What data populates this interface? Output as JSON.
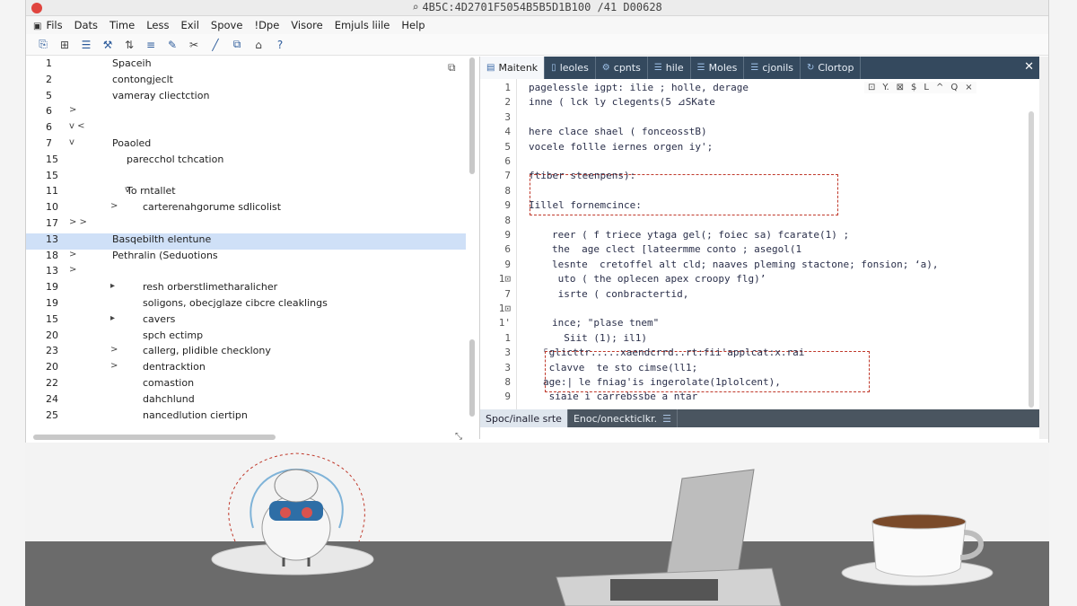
{
  "window": {
    "title": "4B5C:4D2701F5054B5B5D1B100 /41 D00628"
  },
  "menu": [
    "Fils",
    "Dats",
    "Time",
    "Less",
    "Exil",
    "Spove",
    "!Dpe",
    "Visore",
    "Emjuls liile",
    "Help"
  ],
  "toolbar_icons": [
    "file-icon",
    "save-icon",
    "list-icon",
    "tools-icon",
    "sort-icon",
    "format-icon",
    "edit-icon",
    "cut-icon",
    "pen-icon",
    "copy-icon",
    "bookmark-icon",
    "help-icon"
  ],
  "tree": {
    "rows": [
      {
        "ln": "1",
        "label": "Spaceih",
        "arrow": "",
        "indent": 0
      },
      {
        "ln": "2",
        "label": "contongjeclt",
        "arrow": "",
        "indent": 0
      },
      {
        "ln": "5",
        "label": "vameray cliectction",
        "arrow": "",
        "indent": 0
      },
      {
        "ln": "6",
        "label": "",
        "arrow": ">",
        "indent": 0
      },
      {
        "ln": "6",
        "label": "",
        "arrow": "v <",
        "indent": 0
      },
      {
        "ln": "7",
        "label": "Poaoled",
        "arrow": "v",
        "indent": 0
      },
      {
        "ln": "15",
        "label": "parecchol tchcation",
        "arrow": "",
        "indent": 1
      },
      {
        "ln": "15",
        "label": "",
        "arrow": "",
        "indent": 0
      },
      {
        "ln": "11",
        "label": "To rntallet",
        "arrow": "v",
        "indent": 1
      },
      {
        "ln": "10",
        "label": "carterenahgorume sdlicolist",
        "arrow": ">",
        "indent": 2
      },
      {
        "ln": "17",
        "label": "",
        "arrow": "> >",
        "indent": 0
      },
      {
        "ln": "13",
        "label": "Basqebilth elentune",
        "arrow": "",
        "indent": 0,
        "selected": true
      },
      {
        "ln": "18",
        "label": "Pethralin (Seduotions",
        "arrow": ">",
        "indent": 0
      },
      {
        "ln": "13",
        "label": "",
        "arrow": ">",
        "indent": 0
      },
      {
        "ln": "19",
        "label": "resh orberstlimetharalicher",
        "arrow": "▸",
        "indent": 2
      },
      {
        "ln": "19",
        "label": "soligons, obecjglaze cibcre cleaklings",
        "arrow": "",
        "indent": 2
      },
      {
        "ln": "15",
        "label": "cavers",
        "arrow": "▸",
        "indent": 2
      },
      {
        "ln": "20",
        "label": "spch ectimp",
        "arrow": "",
        "indent": 2
      },
      {
        "ln": "23",
        "label": "callerg, plidible checklony",
        "arrow": ">",
        "indent": 2
      },
      {
        "ln": "20",
        "label": "dentracktion",
        "arrow": ">",
        "indent": 2
      },
      {
        "ln": "22",
        "label": "comastion",
        "arrow": "",
        "indent": 2
      },
      {
        "ln": "24",
        "label": "dahchlund",
        "arrow": "",
        "indent": 2
      },
      {
        "ln": "25",
        "label": "nancedlution ciertipn",
        "arrow": "",
        "indent": 2
      }
    ]
  },
  "tabs": [
    {
      "label": "Maitenk",
      "icon": "file-icon",
      "active": true
    },
    {
      "label": "leoles",
      "icon": "doc-icon"
    },
    {
      "label": "cpnts",
      "icon": "gear-icon"
    },
    {
      "label": "hile",
      "icon": "list-icon"
    },
    {
      "label": "Moles",
      "icon": "list-icon"
    },
    {
      "label": "cjonils",
      "icon": "list-icon"
    },
    {
      "label": "Clortop",
      "icon": "refresh-icon"
    }
  ],
  "find_bar": [
    "⊡",
    "Y.",
    "⊠",
    "$",
    "L",
    "^",
    "Q",
    "×"
  ],
  "code": [
    {
      "ln": "1",
      "text": "pagelessle igpt: ilie ; holle, derage",
      "indent": 0
    },
    {
      "ln": "2",
      "text": "inne ( lck ly clegents(5 ⊿SKate",
      "indent": 0
    },
    {
      "ln": "3",
      "text": "",
      "indent": 0
    },
    {
      "ln": "4",
      "text": "here clace shael ( fonceosstB)",
      "indent": 0
    },
    {
      "ln": "5",
      "text": "vocele follle iernes orgen iy';",
      "indent": 0
    },
    {
      "ln": "6",
      "text": "",
      "indent": 0
    },
    {
      "ln": "7",
      "text": "ftiber steenpens):",
      "indent": 0
    },
    {
      "ln": "8",
      "text": "",
      "indent": 0
    },
    {
      "ln": "9",
      "text": "Iillel fornemcince:",
      "indent": 0
    },
    {
      "ln": "8",
      "text": "",
      "indent": 0
    },
    {
      "ln": "9",
      "text": "reer ( f triece ytaga gel(; foiec sa) fcarate(1) ;",
      "indent": 2
    },
    {
      "ln": "6",
      "text": "the  age clect [lateermme conto ; asegol(1",
      "indent": 2
    },
    {
      "ln": "9",
      "text": "lesnte  cretoffel alt cld; naaves pleming stactone; fonsion; ‘a),",
      "indent": 2
    },
    {
      "ln": "1⊡",
      "text": " uto ( the oplecen apex croopy flg)’",
      "indent": 2
    },
    {
      "ln": "7",
      "text": " isrte ( conbractertid,",
      "indent": 2
    },
    {
      "ln": "1⊡",
      "text": "",
      "indent": 0
    },
    {
      "ln": "1'",
      "text": "ince; \"plase tnem\"",
      "indent": 2
    },
    {
      "ln": "1",
      "text": "  Siit (1); il1)",
      "indent": 2
    },
    {
      "ln": "3",
      "text": "⌜glicttr.....xaendcrrd..rt:fii'applcat:x.rai",
      "indent": 1
    },
    {
      "ln": "3",
      "text": " clavve  te sto cimse(ll1;",
      "indent": 1
    },
    {
      "ln": "8",
      "text": "age:| le fniag'is ingerolate(1plolcent),",
      "indent": 1
    },
    {
      "ln": "9",
      "text": " siaie i carrebssbe a ntar",
      "indent": 1
    }
  ],
  "status": [
    {
      "label": "Spoc/inalle srte",
      "active": true
    },
    {
      "label": "Enoc/oneckticlkr.",
      "active": false,
      "icon": "list-icon"
    }
  ]
}
